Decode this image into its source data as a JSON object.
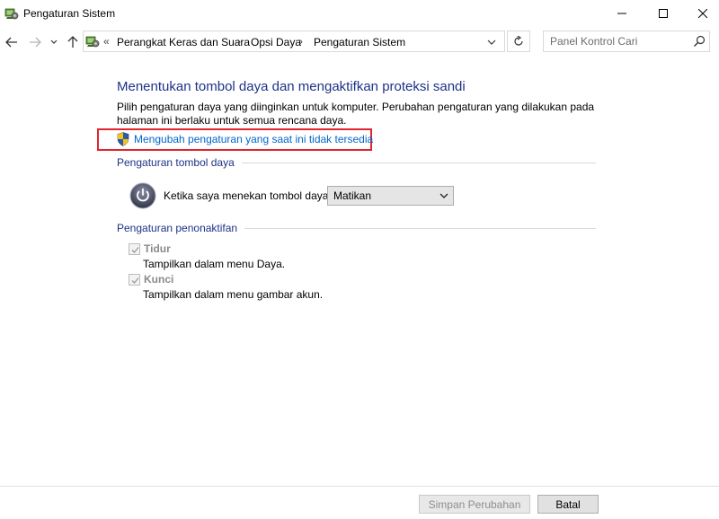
{
  "window": {
    "title": "Pengaturan Sistem",
    "icon": "control-panel-icon"
  },
  "address_bar": {
    "overflow": "«",
    "breadcrumbs": [
      "Perangkat Keras dan Suara",
      "Opsi Daya",
      "Pengaturan Sistem"
    ],
    "separator": "›"
  },
  "search": {
    "placeholder": "Panel Kontrol Cari"
  },
  "main": {
    "title": "Menentukan tombol daya dan mengaktifkan proteksi sandi",
    "description": "Pilih pengaturan daya yang diinginkan untuk komputer. Perubahan pengaturan yang dilakukan pada halaman ini berlaku untuk semua rencana daya.",
    "uac_link": "Mengubah pengaturan yang saat ini tidak tersedia",
    "highlight_color": "#e0262e",
    "power_button_section": {
      "heading": "Pengaturan tombol daya",
      "label": "Ketika saya menekan tombol daya:",
      "selected": "Matikan"
    },
    "shutdown_section": {
      "heading": "Pengaturan penonaktifan",
      "options": [
        {
          "label": "Tidur",
          "description": "Tampilkan dalam menu Daya.",
          "checked": true,
          "enabled": false
        },
        {
          "label": "Kunci",
          "description": "Tampilkan dalam menu gambar akun.",
          "checked": true,
          "enabled": false
        }
      ]
    }
  },
  "footer": {
    "save_label": "Simpan Perubahan",
    "cancel_label": "Batal"
  },
  "colors": {
    "heading": "#1e3287",
    "link": "#0066cc"
  }
}
